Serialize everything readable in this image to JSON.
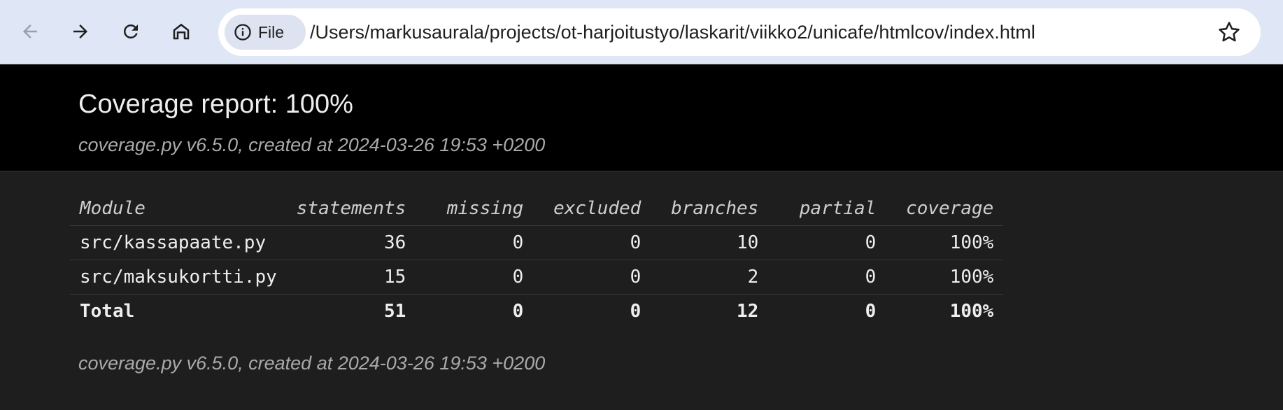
{
  "browser": {
    "chip_label": "File",
    "url": "/Users/markusaurala/projects/ot-harjoitustyo/laskarit/viikko2/unicafe/htmlcov/index.html",
    "icons": [
      "back-arrow-icon",
      "forward-arrow-icon",
      "reload-icon",
      "home-icon",
      "info-icon",
      "star-icon"
    ]
  },
  "report": {
    "title": "Coverage report: 100%",
    "meta": "coverage.py v6.5.0, created at 2024-03-26 19:53 +0200",
    "footer": "coverage.py v6.5.0, created at 2024-03-26 19:53 +0200"
  },
  "table": {
    "headers": [
      "Module",
      "statements",
      "missing",
      "excluded",
      "branches",
      "partial",
      "coverage"
    ],
    "rows": [
      [
        "src/kassapaate.py",
        "36",
        "0",
        "0",
        "10",
        "0",
        "100%"
      ],
      [
        "src/maksukortti.py",
        "15",
        "0",
        "0",
        "2",
        "0",
        "100%"
      ]
    ],
    "total": [
      "Total",
      "51",
      "0",
      "0",
      "12",
      "0",
      "100%"
    ]
  },
  "colors": {
    "header_bg": "#000000",
    "page_bg": "#1e1e1e",
    "toolbar_bg": "#dfe6f5"
  }
}
